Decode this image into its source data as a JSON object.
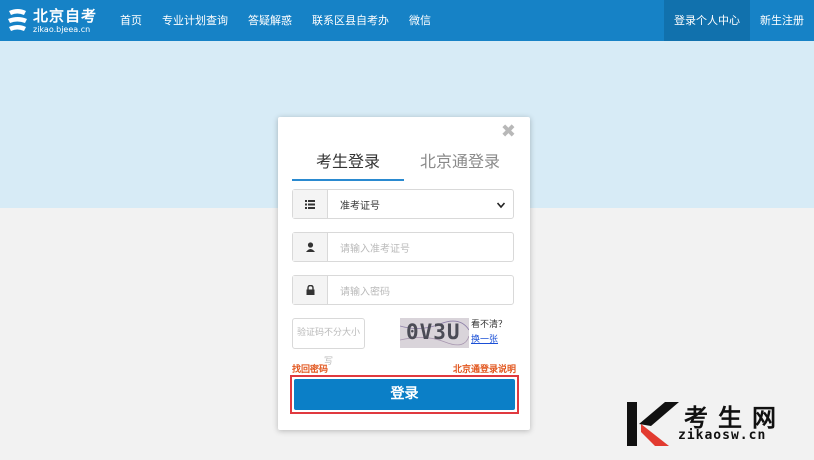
{
  "logo": {
    "cn": "北京自考",
    "en": "zikao.bjeea.cn"
  },
  "nav": {
    "items": [
      "首页",
      "专业计划查询",
      "答疑解惑",
      "联系区县自考办",
      "微信"
    ]
  },
  "nav_right": {
    "login_center": "登录个人中心",
    "register": "新生注册"
  },
  "modal": {
    "close": "✖",
    "tabs": [
      "考生登录",
      "北京通登录"
    ],
    "id_type": {
      "value": "准考证号"
    },
    "id_input": {
      "placeholder": "请输入准考证号"
    },
    "password_input": {
      "placeholder": "请输入密码"
    },
    "captcha_input": {
      "placeholder": "验证码不分大小写"
    },
    "captcha_text": "0V3U",
    "captcha_hint": "看不清？",
    "captcha_refresh": "换一张",
    "forgot": "找回密码",
    "bjt_help": "北京通登录说明",
    "login_button": "登录"
  },
  "watermark": {
    "cn": "考生网",
    "en": "zikaosw.cn"
  },
  "colors": {
    "topbar": "#1682c6",
    "accent": "#0b7fc7",
    "link": "#e2571f",
    "hero": "#d7ebf6"
  }
}
